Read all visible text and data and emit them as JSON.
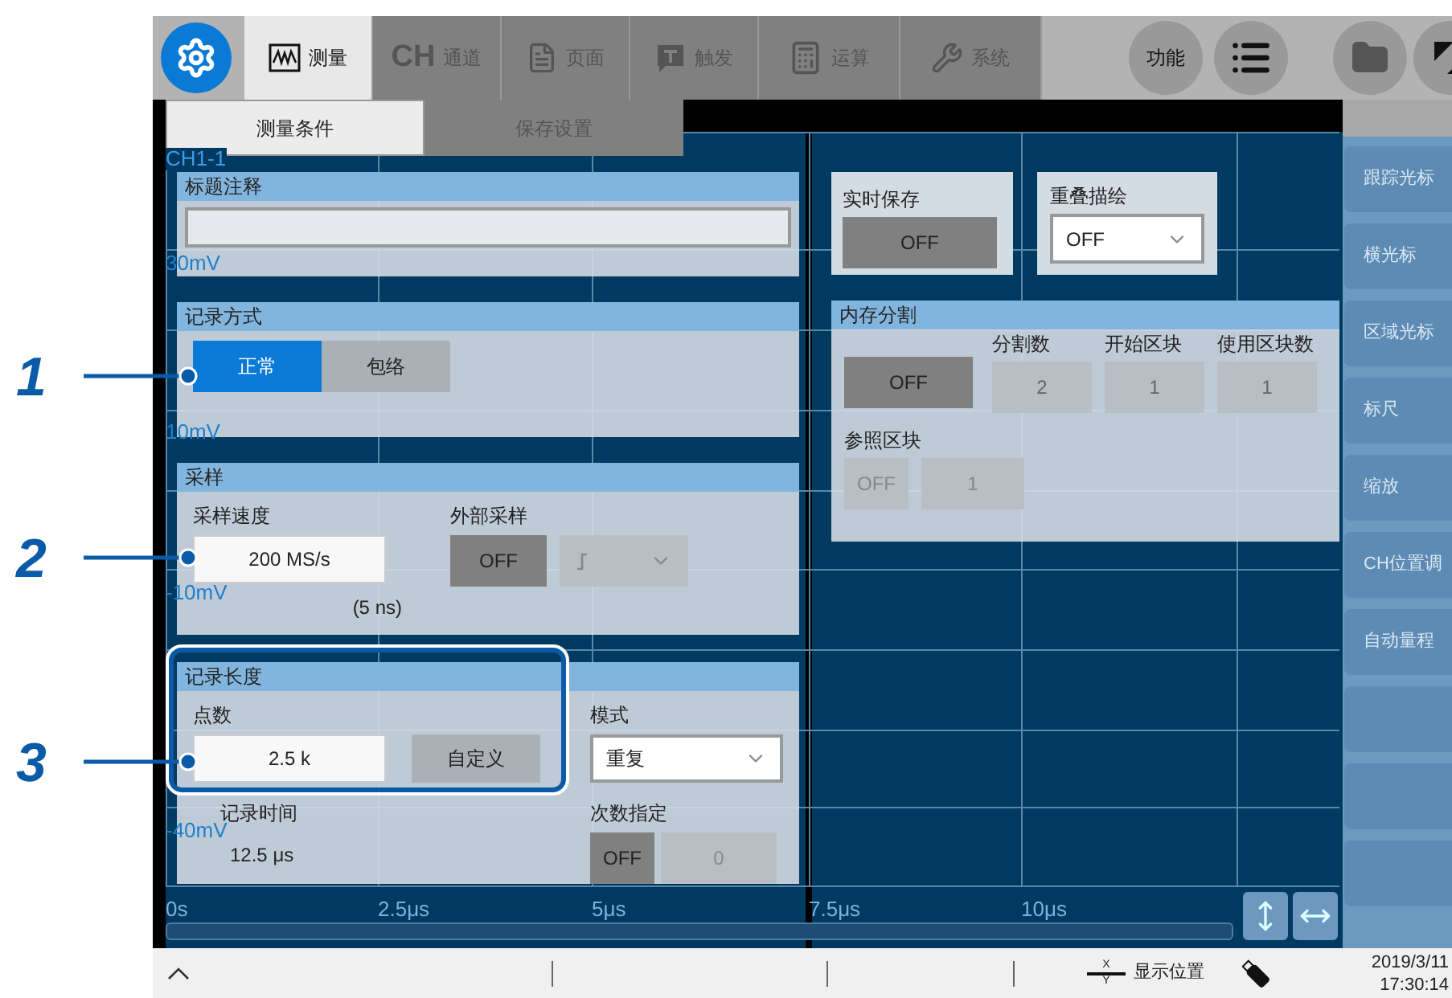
{
  "callouts": [
    "1",
    "2",
    "3"
  ],
  "toolbar": {
    "tabs": [
      {
        "kind": "wave",
        "label": "测量",
        "selected": true
      },
      {
        "kind": "ch",
        "badge": "CH",
        "label": "通道",
        "selected": false
      },
      {
        "kind": "page",
        "label": "页面",
        "selected": false
      },
      {
        "kind": "trigger",
        "label": "触发",
        "selected": false
      },
      {
        "kind": "math",
        "label": "运算",
        "selected": false
      },
      {
        "kind": "wrench",
        "label": "系统",
        "selected": false
      }
    ],
    "function_button": "功能"
  },
  "subtabs": [
    {
      "label": "测量条件",
      "selected": true
    },
    {
      "label": "保存设置",
      "selected": false
    }
  ],
  "graph": {
    "channel": "CH1-1",
    "y_labels": [
      "30mV",
      "10mV",
      "-10mV",
      "-40mV"
    ],
    "x_labels": [
      "0s",
      "2.5μs",
      "5μs",
      "7.5μs",
      "10μs"
    ]
  },
  "side_buttons": [
    {
      "kind": "text",
      "label": "跟踪光标"
    },
    {
      "kind": "text",
      "label": "横光标"
    },
    {
      "kind": "text",
      "label": "区域光标"
    },
    {
      "kind": "text",
      "label": "标尺"
    },
    {
      "kind": "text",
      "label": "缩放"
    },
    {
      "kind": "text",
      "label": "CH位置调"
    },
    {
      "kind": "text",
      "label": "自动量程"
    },
    {
      "kind": "blank"
    },
    {
      "kind": "blank"
    },
    {
      "kind": "blank"
    }
  ],
  "title_note": {
    "title": "标题注释"
  },
  "record_mode": {
    "title": "记录方式",
    "options": [
      {
        "label": "正常",
        "selected": true
      },
      {
        "label": "包络",
        "selected": false
      }
    ]
  },
  "sampling": {
    "title": "采样",
    "rate_label": "采样速度",
    "rate": "200 MS/s",
    "period": "(5 ns)",
    "external_label": "外部采样",
    "external": {
      "label": "OFF",
      "on": false
    },
    "slope_disabled": true
  },
  "record_length": {
    "title": "记录长度",
    "points_label": "点数",
    "points": "2.5 k",
    "custom": "自定义",
    "time_label": "记录时间",
    "time": "12.5 μs",
    "mode_label": "模式",
    "mode": "重复",
    "count_label": "次数指定",
    "count_toggle": {
      "label": "OFF",
      "on": false
    },
    "count": "0",
    "count_disabled": true
  },
  "realtime_save": {
    "title": "实时保存",
    "toggle": {
      "label": "OFF",
      "on": false
    }
  },
  "overlay": {
    "title": "重叠描绘",
    "value": "OFF"
  },
  "memory_division": {
    "title": "内存分割",
    "toggle": {
      "label": "OFF",
      "on": false
    },
    "fields": [
      {
        "label": "分割数",
        "value": "2"
      },
      {
        "label": "开始区块",
        "value": "1"
      },
      {
        "label": "使用区块数",
        "value": "1"
      }
    ],
    "ref_label": "参照区块",
    "ref_toggle": "OFF",
    "ref_value": "1",
    "disabled": true
  },
  "status_bar": {
    "x_letter": "X",
    "y_letter": "Y",
    "position_label": "显示位置",
    "date": "2019/3/11",
    "time": "17:30:14"
  }
}
